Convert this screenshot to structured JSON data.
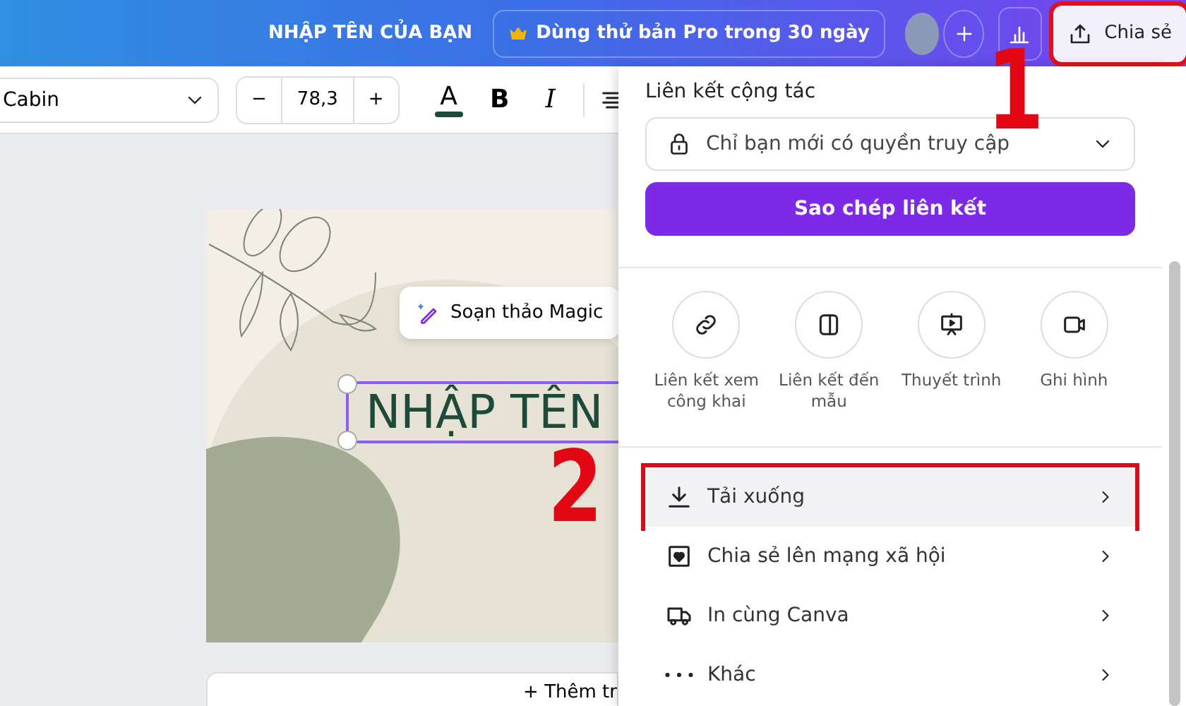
{
  "top_bar": {
    "title": "NHẬP TÊN CỦA BẠN",
    "pro_trial": "Dùng thử bản Pro trong 30 ngày",
    "share_button": {
      "label": "Chia sẻ",
      "highlighted": true
    }
  },
  "toolbar": {
    "font": "Cabin",
    "font_size": {
      "minus": "−",
      "value": "78,3",
      "plus": "+"
    },
    "color_letter": "A",
    "bold": "B",
    "italic": "I"
  },
  "canvas": {
    "magic_write": "Soạn thảo Magic",
    "text": "NHẬP TÊN",
    "add_page": "+ Thêm tr"
  },
  "share_panel": {
    "heading": "Liên kết cộng tác",
    "access": "Chỉ bạn mới có quyền truy cập",
    "copy_button": "Sao chép liên kết",
    "options": [
      {
        "kind": "link",
        "label": "Liên kết xem công khai"
      },
      {
        "kind": "template",
        "label": "Liên kết đến mẫu"
      },
      {
        "kind": "present",
        "label": "Thuyết trình"
      },
      {
        "kind": "record",
        "label": "Ghi hình"
      }
    ],
    "menu": [
      {
        "kind": "download",
        "label": "Tải xuống",
        "highlighted": true
      },
      {
        "kind": "social",
        "label": "Chia sẻ lên mạng xã hội",
        "highlighted": false
      },
      {
        "kind": "print",
        "label": "In cùng Canva",
        "highlighted": false
      },
      {
        "kind": "more",
        "label": "Khác",
        "highlighted": false
      }
    ]
  },
  "annotations": [
    {
      "text": "1"
    },
    {
      "text": "2"
    }
  ]
}
